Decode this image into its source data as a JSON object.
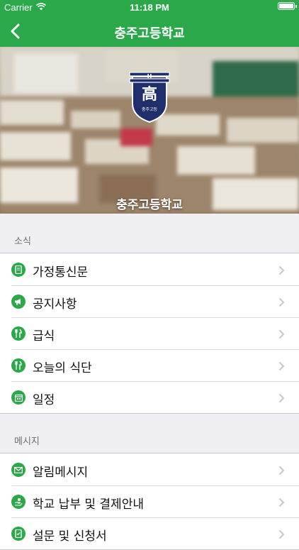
{
  "status_bar": {
    "carrier": "Carrier",
    "time": "11:18 PM",
    "battery_level": 1.0,
    "icons": [
      "wifi-icon",
      "battery-icon"
    ]
  },
  "nav": {
    "title": "충주고등학교",
    "back_icon": "chevron-left-icon"
  },
  "hero": {
    "school_name": "충주고등학교",
    "emblem_text": "高",
    "emblem_sub": "충주고등"
  },
  "sections": [
    {
      "header": "소식",
      "items": [
        {
          "label": "가정통신문",
          "icon": "document-icon"
        },
        {
          "label": "공지사항",
          "icon": "megaphone-icon"
        },
        {
          "label": "급식",
          "icon": "utensils-icon"
        },
        {
          "label": "오늘의 식단",
          "icon": "utensils-icon"
        },
        {
          "label": "일정",
          "icon": "calendar-icon"
        }
      ]
    },
    {
      "header": "메시지",
      "items": [
        {
          "label": "알림메시지",
          "icon": "envelope-icon"
        },
        {
          "label": "학교 납부 및 결제안내",
          "icon": "payment-icon"
        },
        {
          "label": "설문 및 신청서",
          "icon": "survey-icon"
        }
      ]
    }
  ],
  "colors": {
    "brand_green": "#2ba84a",
    "background": "#efeff4",
    "section_text": "#6d6d72"
  }
}
